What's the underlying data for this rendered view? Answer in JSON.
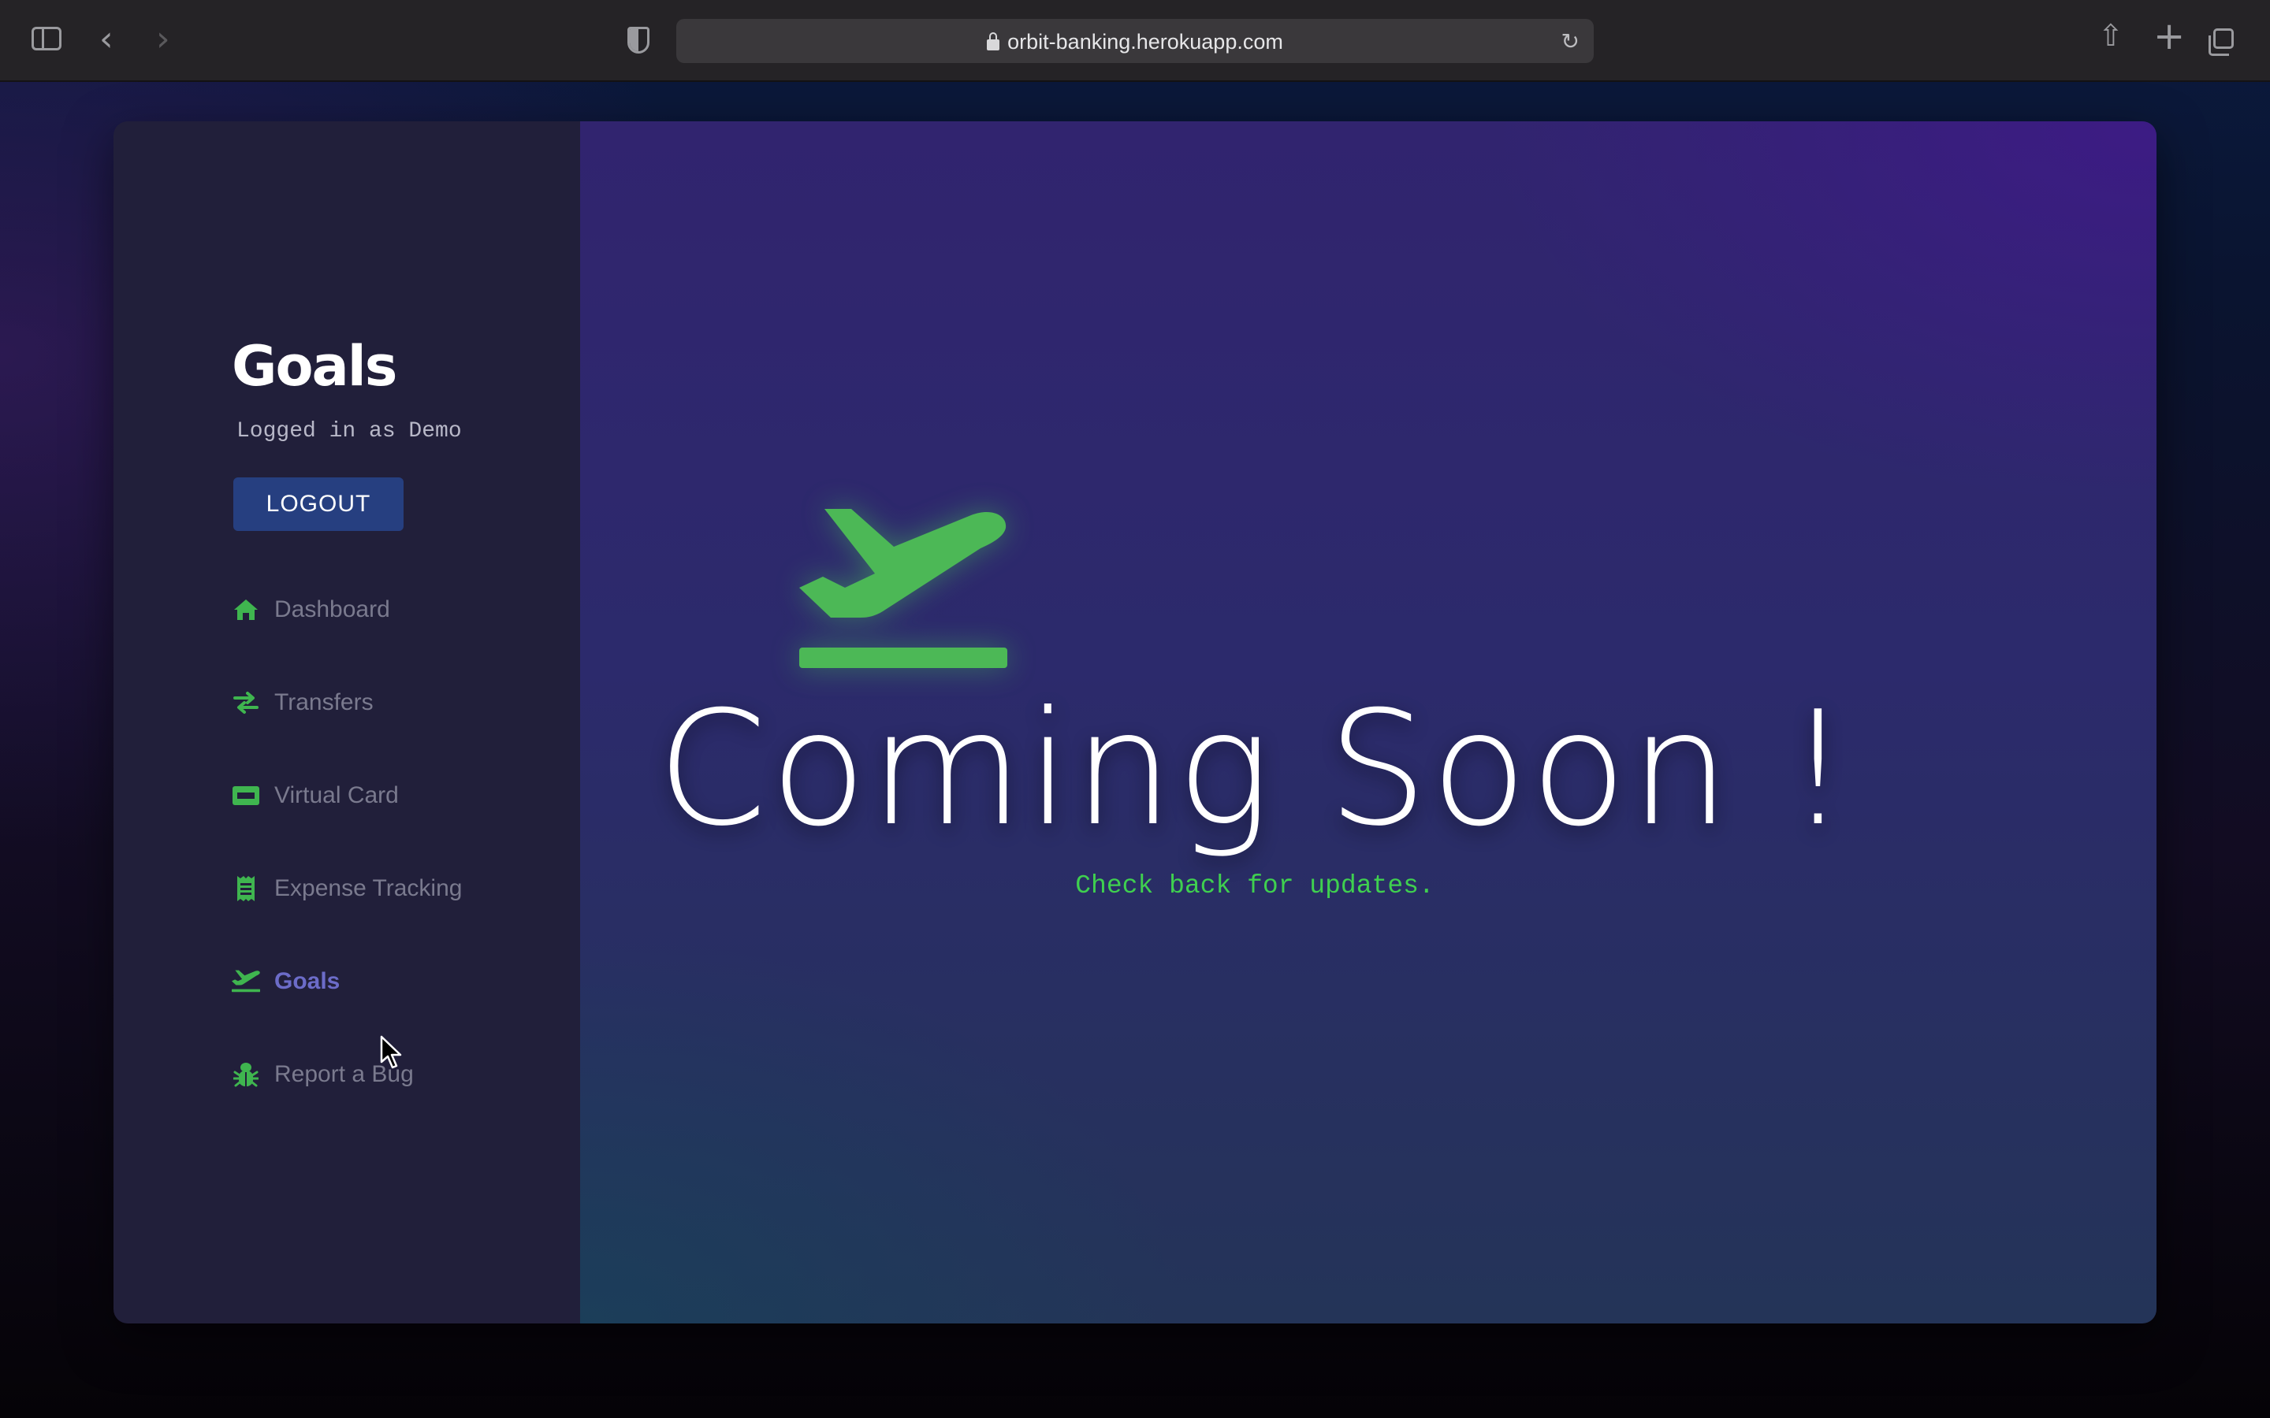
{
  "browser": {
    "url": "orbit-banking.herokuapp.com"
  },
  "sidebar": {
    "title": "Goals",
    "logged_in_text": "Logged in as Demo",
    "logout_label": "LOGOUT",
    "items": [
      {
        "label": "Dashboard",
        "icon": "home-icon",
        "active": false
      },
      {
        "label": "Transfers",
        "icon": "transfer-arrows-icon",
        "active": false
      },
      {
        "label": "Virtual Card",
        "icon": "visa-card-icon",
        "active": false
      },
      {
        "label": "Expense Tracking",
        "icon": "receipt-icon",
        "active": false
      },
      {
        "label": "Goals",
        "icon": "plane-departure-icon",
        "active": true
      },
      {
        "label": "Report a Bug",
        "icon": "bug-icon",
        "active": false
      }
    ]
  },
  "main": {
    "heading": "Coming Soon !",
    "subtitle": "Check back for updates.",
    "hero_icon": "plane-departure-icon"
  },
  "colors": {
    "accent_green": "#3fb54f",
    "active_nav": "#6c6cc8",
    "logout_button": "#263f80",
    "sidebar_bg": "#211f3a"
  }
}
